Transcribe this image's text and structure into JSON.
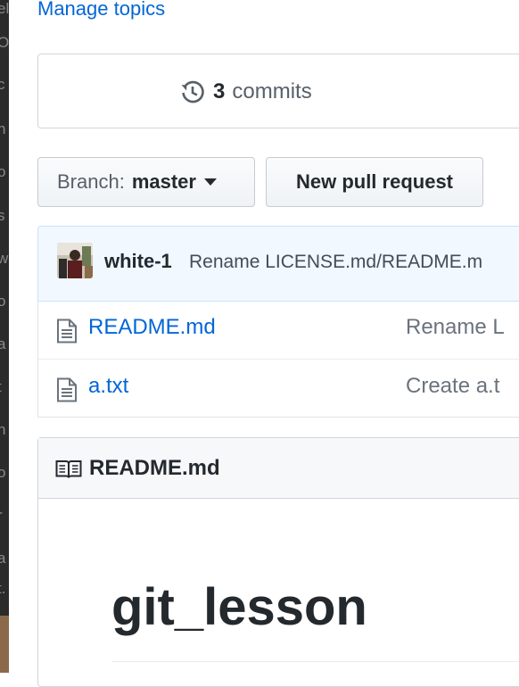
{
  "topics": {
    "manage_label": "Manage topics"
  },
  "commits": {
    "count": "3",
    "label": "commits"
  },
  "branch_button": {
    "prefix": "Branch:",
    "name": "master"
  },
  "pull_request_button": {
    "label": "New pull request"
  },
  "latest_commit": {
    "author": "white-1",
    "message": "Rename LICENSE.md/README.m"
  },
  "files": [
    {
      "name": "README.md",
      "message": "Rename L"
    },
    {
      "name": "a.txt",
      "message": "Create a.t"
    }
  ],
  "readme": {
    "header_title": "README.md",
    "heading": "git_lesson"
  },
  "background_window": {
    "glyphs": [
      "el",
      "O",
      "c",
      "h",
      "o",
      "s",
      "w",
      "o",
      "a",
      "t",
      "h",
      "o",
      "r",
      "a",
      "t."
    ]
  },
  "colors": {
    "link": "#0366d6",
    "commit_tease_bg": "#f1f8ff",
    "text": "#24292e",
    "muted": "#586069"
  },
  "icons": {
    "history": "history-icon",
    "file": "file-icon",
    "book": "book-icon",
    "caret": "caret-down-icon"
  }
}
